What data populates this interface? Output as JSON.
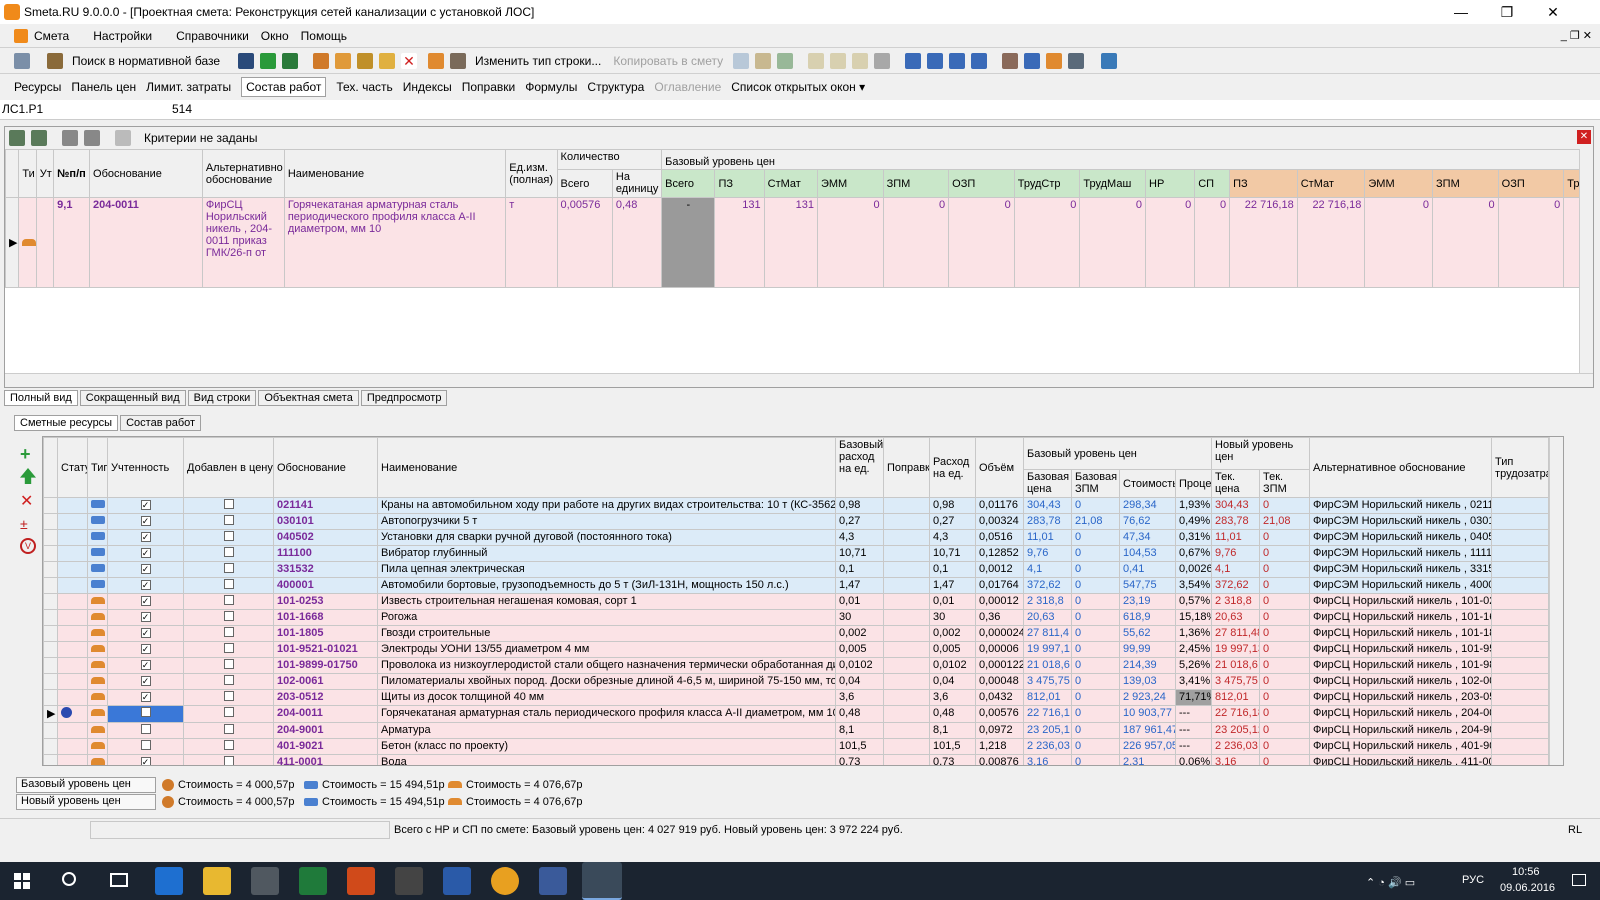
{
  "window": {
    "title": "Smeta.RU 9.0.0.0 - [Проектная смета: Реконструкция сетей канализации с установкой ЛОС]"
  },
  "menu": [
    "Смета",
    "Настройки",
    "Справочники",
    "Окно",
    "Помощь"
  ],
  "toolbar": {
    "search": "Поиск в нормативной базе",
    "change_type": "Изменить тип строки...",
    "copy": "Копировать в смету"
  },
  "tabs": [
    "Ресурсы",
    "Панель цен",
    "Лимит. затраты",
    "Состав работ",
    "Тех. часть",
    "Индексы",
    "Поправки",
    "Формулы",
    "Структура",
    "Оглавление",
    "Список открытых окон ▾"
  ],
  "address": {
    "cell": "ЛС1.Р1",
    "value": "514"
  },
  "criteria": "Критерии не заданы",
  "top_headers": [
    "Ти",
    "Ут",
    "№п/п",
    "Обоснование",
    "Альтернативно обоснование",
    "Наименование",
    "Ед.изм. (полная)",
    "Количество",
    "Всего",
    "На единицу",
    "Базовый уровень цен",
    "Всего",
    "ПЗ",
    "СтМат",
    "ЭММ",
    "ЗПМ",
    "ОЗП",
    "ТрудСтр",
    "ТрудМаш",
    "НР",
    "СП",
    "ПЗ",
    "СтМат",
    "ЭММ",
    "ЗПМ",
    "ОЗП",
    "Тр"
  ],
  "top_row": {
    "num": "9,1",
    "code": "204-0011",
    "alt": "ФирСЦ Норильский никель , 204-0011 приказ ГМК/26-п от",
    "name": "Горячекатаная арматурная сталь периодического профиля класса А-II диаметром, мм 10",
    "unit": "т",
    "total": "0,00576",
    "per": "0,48",
    "vsego": "-",
    "pz": "131",
    "stmat": "131",
    "emm": "0",
    "zpm": "0",
    "ozp": "0",
    "trstr": "0",
    "trmash": "0",
    "nr": "0",
    "sp": "0",
    "pz2": "22 716,18",
    "stmat2": "22 716,18",
    "emm2": "0",
    "zpm2": "0",
    "ozp2": "0"
  },
  "view_tabs": [
    "Полный вид",
    "Сокращенный вид",
    "Вид строки",
    "Объектная смета",
    "Предпросмотр"
  ],
  "sub_tabs": [
    "Сметные ресурсы",
    "Состав работ"
  ],
  "bottom_headers": [
    "Статус",
    "Тип",
    "Учтенность",
    "Добавлен в цену",
    "Обоснование",
    "Наименование",
    "Базовый расход на ед.",
    "Поправки",
    "Расход на ед.",
    "Объём",
    "Базовый уровень цен",
    "Базовая цена",
    "Базовая ЗПМ",
    "Стоимость",
    "Процент",
    "Новый уровень цен",
    "Тек. цена",
    "Тек. ЗПМ",
    "Альтернативное обоснование",
    "Тип трудозатрат"
  ],
  "rows": [
    {
      "t": "m",
      "chk": true,
      "code": "021141",
      "name": "Краны на автомобильном ходу при работе на других видах строительства: 10 т (КС-3562)",
      "brate": "0,98",
      "rate": "0,98",
      "vol": "0,01176",
      "bprice": "304,43",
      "bzpm": "0",
      "cost": "298,34",
      "pct": "1,93%",
      "tprice": "304,43",
      "tzpm": "0",
      "alt": "ФирСЭМ Норильский никель , 0211"
    },
    {
      "t": "m",
      "chk": true,
      "code": "030101",
      "name": "Автопогрузчики 5 т",
      "brate": "0,27",
      "rate": "0,27",
      "vol": "0,00324",
      "bprice": "283,78",
      "bzpm": "21,08",
      "cost": "76,62",
      "pct": "0,49%",
      "tprice": "283,78",
      "tzpm": "21,08",
      "alt": "ФирСЭМ Норильский никель , 0301"
    },
    {
      "t": "m",
      "chk": true,
      "code": "040502",
      "name": "Установки для сварки ручной дуговой (постоянного тока)",
      "brate": "4,3",
      "rate": "4,3",
      "vol": "0,0516",
      "bprice": "11,01",
      "bzpm": "0",
      "cost": "47,34",
      "pct": "0,31%",
      "tprice": "11,01",
      "tzpm": "0",
      "alt": "ФирСЭМ Норильский никель , 0405"
    },
    {
      "t": "m",
      "chk": true,
      "code": "111100",
      "name": "Вибратор глубинный",
      "brate": "10,71",
      "rate": "10,71",
      "vol": "0,12852",
      "bprice": "9,76",
      "bzpm": "0",
      "cost": "104,53",
      "pct": "0,67%",
      "tprice": "9,76",
      "tzpm": "0",
      "alt": "ФирСЭМ Норильский никель , 1111"
    },
    {
      "t": "m",
      "chk": true,
      "code": "331532",
      "name": "Пила цепная электрическая",
      "brate": "0,1",
      "rate": "0,1",
      "vol": "0,0012",
      "bprice": "4,1",
      "bzpm": "0",
      "cost": "0,41",
      "pct": "0,0026%",
      "tprice": "4,1",
      "tzpm": "0",
      "alt": "ФирСЭМ Норильский никель , 3315"
    },
    {
      "t": "m",
      "chk": true,
      "code": "400001",
      "name": "Автомобили бортовые, грузоподъемность до 5 т (ЗиЛ-131Н, мощность 150 л.с.)",
      "brate": "1,47",
      "rate": "1,47",
      "vol": "0,01764",
      "bprice": "372,62",
      "bzpm": "0",
      "cost": "547,75",
      "pct": "3,54%",
      "tprice": "372,62",
      "tzpm": "0",
      "alt": "ФирСЭМ Норильский никель , 4000"
    },
    {
      "t": "r",
      "chk": true,
      "code": "101-0253",
      "name": "Известь строительная негашеная комовая, сорт 1",
      "brate": "0,01",
      "rate": "0,01",
      "vol": "0,00012",
      "bprice": "2 318,8",
      "bzpm": "0",
      "cost": "23,19",
      "pct": "0,57%",
      "tprice": "2 318,8",
      "tzpm": "0",
      "alt": "ФирСЦ Норильский никель , 101-02"
    },
    {
      "t": "r",
      "chk": true,
      "code": "101-1668",
      "name": "Рогожа",
      "brate": "30",
      "rate": "30",
      "vol": "0,36",
      "bprice": "20,63",
      "bzpm": "0",
      "cost": "618,9",
      "pct": "15,18%",
      "tprice": "20,63",
      "tzpm": "0",
      "alt": "ФирСЦ Норильский никель , 101-16"
    },
    {
      "t": "r",
      "chk": true,
      "code": "101-1805",
      "name": "Гвозди строительные",
      "brate": "0,002",
      "rate": "0,002",
      "vol": "0,000024",
      "bprice": "27 811,4",
      "bzpm": "0",
      "cost": "55,62",
      "pct": "1,36%",
      "tprice": "27 811,48",
      "tzpm": "0",
      "alt": "ФирСЦ Норильский никель , 101-18"
    },
    {
      "t": "r",
      "chk": true,
      "code": "101-9521-01021",
      "name": "Электроды УОНИ 13/55 диаметром 4 мм",
      "brate": "0,005",
      "rate": "0,005",
      "vol": "0,00006",
      "bprice": "19 997,1",
      "bzpm": "0",
      "cost": "99,99",
      "pct": "2,45%",
      "tprice": "19 997,13",
      "tzpm": "0",
      "alt": "ФирСЦ Норильский никель , 101-95"
    },
    {
      "t": "r",
      "chk": true,
      "code": "101-9899-01750",
      "name": "Проволока из низкоуглеродистой стали общего назначения термически обработанная диа",
      "brate": "0,0102",
      "rate": "0,0102",
      "vol": "0,000122",
      "bprice": "21 018,6",
      "bzpm": "0",
      "cost": "214,39",
      "pct": "5,26%",
      "tprice": "21 018,6",
      "tzpm": "0",
      "alt": "ФирСЦ Норильский никель , 101-98"
    },
    {
      "t": "r",
      "chk": true,
      "code": "102-0061",
      "name": "Пиломатериалы хвойных пород. Доски обрезные длиной 4-6,5 м, шириной 75-150 мм, тол",
      "brate": "0,04",
      "rate": "0,04",
      "vol": "0,00048",
      "bprice": "3 475,75",
      "bzpm": "0",
      "cost": "139,03",
      "pct": "3,41%",
      "tprice": "3 475,75",
      "tzpm": "0",
      "alt": "ФирСЦ Норильский никель , 102-00"
    },
    {
      "t": "r",
      "chk": true,
      "code": "203-0512",
      "name": "Щиты из досок толщиной 40 мм",
      "brate": "3,6",
      "rate": "3,6",
      "vol": "0,0432",
      "bprice": "812,01",
      "bzpm": "0",
      "cost": "2 923,24",
      "pct": "71,71%",
      "tprice": "812,01",
      "tzpm": "0",
      "alt": "ФирСЦ Норильский никель , 203-05"
    },
    {
      "t": "r",
      "chk": false,
      "code": "204-0011",
      "name": "Горячекатаная арматурная сталь периодического профиля класса А-II диаметром, мм 10",
      "brate": "0,48",
      "rate": "0,48",
      "vol": "0,00576",
      "bprice": "22 716,1",
      "bzpm": "0",
      "cost": "10 903,77",
      "pct": "---",
      "tprice": "22 716,18",
      "tzpm": "0",
      "alt": "ФирСЦ Норильский никель , 204-00",
      "sel": true
    },
    {
      "t": "r",
      "chk": false,
      "code": "204-9001",
      "name": "Арматура",
      "brate": "8,1",
      "rate": "8,1",
      "vol": "0,0972",
      "bprice": "23 205,1",
      "bzpm": "0",
      "cost": "187 961,47",
      "pct": "---",
      "tprice": "23 205,12",
      "tzpm": "0",
      "alt": "ФирСЦ Норильский никель , 204-90"
    },
    {
      "t": "r",
      "chk": false,
      "code": "401-9021",
      "name": "Бетон (класс по проекту)",
      "brate": "101,5",
      "rate": "101,5",
      "vol": "1,218",
      "bprice": "2 236,03",
      "bzpm": "0",
      "cost": "226 957,05",
      "pct": "---",
      "tprice": "2 236,03",
      "tzpm": "0",
      "alt": "ФирСЦ Норильский никель , 401-90"
    },
    {
      "t": "r",
      "chk": true,
      "code": "411-0001",
      "name": "Вода",
      "brate": "0,73",
      "rate": "0,73",
      "vol": "0,00876",
      "bprice": "3,16",
      "bzpm": "0",
      "cost": "2,31",
      "pct": "0,06%",
      "tprice": "3,16",
      "tzpm": "0",
      "alt": "ФирСЦ Норильский никель , 411-00"
    }
  ],
  "summary": {
    "base_label": "Базовый уровень цен",
    "new_label": "Новый уровень цен",
    "c1": "Стоимость = 4 000,57р",
    "c2": "Стоимость = 15 494,51р",
    "c3": "Стоимость = 4 076,67р"
  },
  "status": {
    "text": "Всего с НР и СП по смете: Базовый уровень цен: 4 027 919 руб. Новый уровень цен: 3 972 224 руб.",
    "lang": "RL"
  },
  "taskbar": {
    "time": "10:56",
    "date": "09.06.2016",
    "lang": "РУС"
  }
}
